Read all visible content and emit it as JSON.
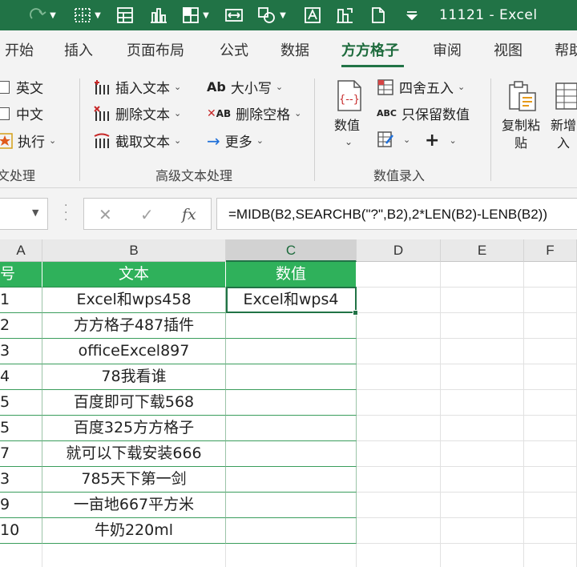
{
  "title_bar": {
    "document_title": "11121  -  Excel",
    "quick_access": [
      "redo-icon",
      "borders-icon",
      "form-icon",
      "chart-icon",
      "table-format-icon",
      "fit-icon",
      "shapes-icon",
      "text-box-icon",
      "chart-type-icon",
      "document-icon",
      "customize-icon"
    ]
  },
  "ribbon_tabs": [
    "开始",
    "插入",
    "页面布局",
    "公式",
    "数据",
    "方方格子",
    "审阅",
    "视图",
    "帮助"
  ],
  "active_tab": "方方格子",
  "ribbon": {
    "group1": {
      "checkboxes": [
        "英文",
        "中文"
      ],
      "exec_label": "执行",
      "label": "文处理"
    },
    "group2": {
      "items": [
        "插入文本",
        "删除文本",
        "截取文本",
        "大小写",
        "删除空格",
        "更多"
      ],
      "icon_labels": {
        "case": "Ab",
        "space": "AB"
      },
      "label": "高级文本处理"
    },
    "group3": {
      "big_button": "数值",
      "items": [
        "四舍五入",
        "只保留数值"
      ],
      "abc_icon": "ABC",
      "plus": "+",
      "label": "数值录入"
    },
    "group4": {
      "copy_paste": [
        "复制粘",
        "贴"
      ],
      "new_insert": [
        "新增",
        "入"
      ]
    }
  },
  "formula_bar": {
    "fx": "fx",
    "formula": "=MIDB(B2,SEARCHB(\"?\",B2),2*LEN(B2)-LENB(B2))"
  },
  "grid": {
    "columns": [
      "A",
      "B",
      "C",
      "D",
      "E",
      "F"
    ],
    "selected_column": "C",
    "header_row": [
      "号",
      "文本",
      "数值"
    ],
    "rows": [
      {
        "a": "1",
        "b": "Excel和wps458",
        "c": "Excel和wps4"
      },
      {
        "a": "2",
        "b": "方方格子487插件",
        "c": ""
      },
      {
        "a": "3",
        "b": "officeExcel897",
        "c": ""
      },
      {
        "a": "4",
        "b": "78我看谁",
        "c": ""
      },
      {
        "a": "5",
        "b": "百度即可下载568",
        "c": ""
      },
      {
        "a": "5",
        "b": "百度325方方格子",
        "c": ""
      },
      {
        "a": "7",
        "b": "就可以下载安装666",
        "c": ""
      },
      {
        "a": "3",
        "b": "785天下第一剑",
        "c": ""
      },
      {
        "a": "9",
        "b": "一亩地667平方米",
        "c": ""
      },
      {
        "a": "10",
        "b": "牛奶220ml",
        "c": ""
      },
      {
        "a": "",
        "b": "",
        "c": ""
      }
    ]
  },
  "colors": {
    "excel_green": "#217346",
    "table_header_green": "#2fb15b"
  }
}
